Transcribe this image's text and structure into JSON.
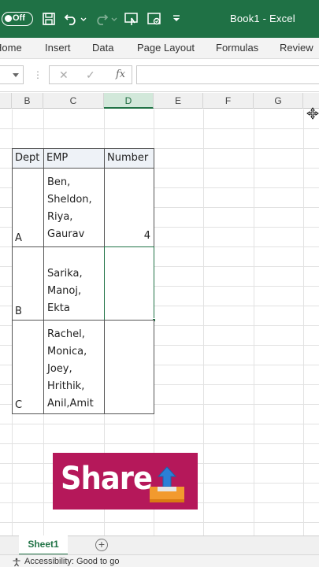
{
  "titlebar": {
    "autosave_label": "Off",
    "doc_title": "Book1  -  Excel",
    "icons": [
      "save-icon",
      "undo-icon",
      "redo-icon",
      "touch-mode-icon",
      "form-icon",
      "customize-qat-icon"
    ]
  },
  "ribbon": {
    "tabs": [
      "Home",
      "Insert",
      "Data",
      "Page Layout",
      "Formulas",
      "Review"
    ]
  },
  "formula_bar": {
    "name_box": "",
    "separator": "⋮",
    "cancel": "✕",
    "enter": "✓",
    "fx": "fx",
    "value": ""
  },
  "grid": {
    "columns": [
      "B",
      "C",
      "D",
      "E",
      "F",
      "G"
    ],
    "active_column": "D"
  },
  "table": {
    "headers": [
      "Dept",
      "EMP",
      "Number"
    ],
    "rows": [
      {
        "dept": "A",
        "emp": [
          "Ben,",
          "Sheldon,",
          "Riya,",
          "Gaurav"
        ],
        "number": "4"
      },
      {
        "dept": "B",
        "emp": [
          "Sarika,",
          "Manoj,",
          "Ekta"
        ],
        "number": ""
      },
      {
        "dept": "C",
        "emp": [
          "Rachel,",
          "Monica,",
          "Joey,",
          "Hrithik,",
          "Anil,Amit"
        ],
        "number": ""
      }
    ]
  },
  "share_banner": {
    "label": "Share"
  },
  "sheets": {
    "tabs": [
      "Sheet1"
    ],
    "add_label": "+"
  },
  "status": {
    "text": "Accessibility: Good to go"
  },
  "colors": {
    "excel_green": "#1f7145",
    "share_bg": "#b5185a",
    "selection": "#217346"
  }
}
